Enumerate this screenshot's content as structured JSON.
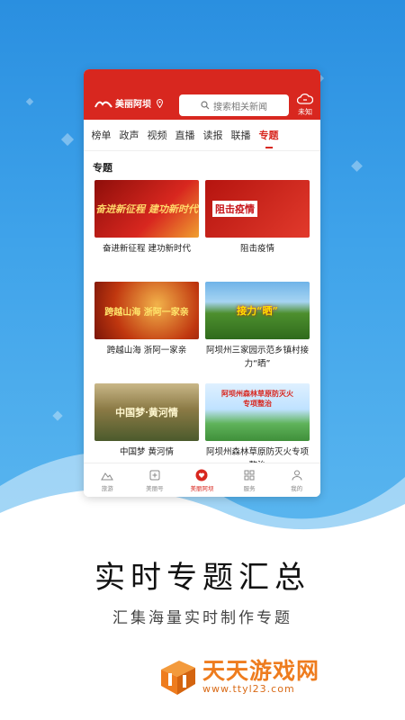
{
  "colors": {
    "primary_red": "#d8271f",
    "bg_blue": "#3b9fe8",
    "watermark_orange": "#ee7c1e"
  },
  "header": {
    "app_name": "美丽阿坝",
    "search_placeholder": "搜索相关新闻",
    "weather_label": "未知"
  },
  "tabs": [
    "榜单",
    "政声",
    "视频",
    "直播",
    "读报",
    "联播",
    "专题"
  ],
  "active_tab": "专题",
  "section_title": "专题",
  "cards": [
    {
      "caption": "奋进新征程 建功新时代",
      "overlay": "奋进新征程 建功新时代"
    },
    {
      "caption": "阻击疫情",
      "overlay": "阻击疫情"
    },
    {
      "caption": "跨越山海 浙阿一家亲",
      "overlay": "跨越山海 浙阿一家亲"
    },
    {
      "caption": "阿坝州三家园示范乡镇村接力“晒”",
      "overlay": "接力“晒”"
    },
    {
      "caption": "中国梦 黄河情",
      "overlay": "中国梦·黄河情"
    },
    {
      "caption": "阿坝州森林草原防灭火专项整治",
      "overlay": "阿坝州森林草原防灭火专项整治"
    }
  ],
  "bottom_nav": [
    {
      "label": "旅游",
      "icon": "mountain-icon"
    },
    {
      "label": "美丽号",
      "icon": "plus-square-icon"
    },
    {
      "label": "美丽阿坝",
      "icon": "heart-circle-icon"
    },
    {
      "label": "服务",
      "icon": "grid-icon"
    },
    {
      "label": "我的",
      "icon": "person-icon"
    }
  ],
  "active_nav": "美丽阿坝",
  "tagline": {
    "title": "实时专题汇总",
    "subtitle": "汇集海量实时制作专题"
  },
  "watermark": {
    "brand": "天天游戏网",
    "url": "www.ttyl23.com"
  }
}
